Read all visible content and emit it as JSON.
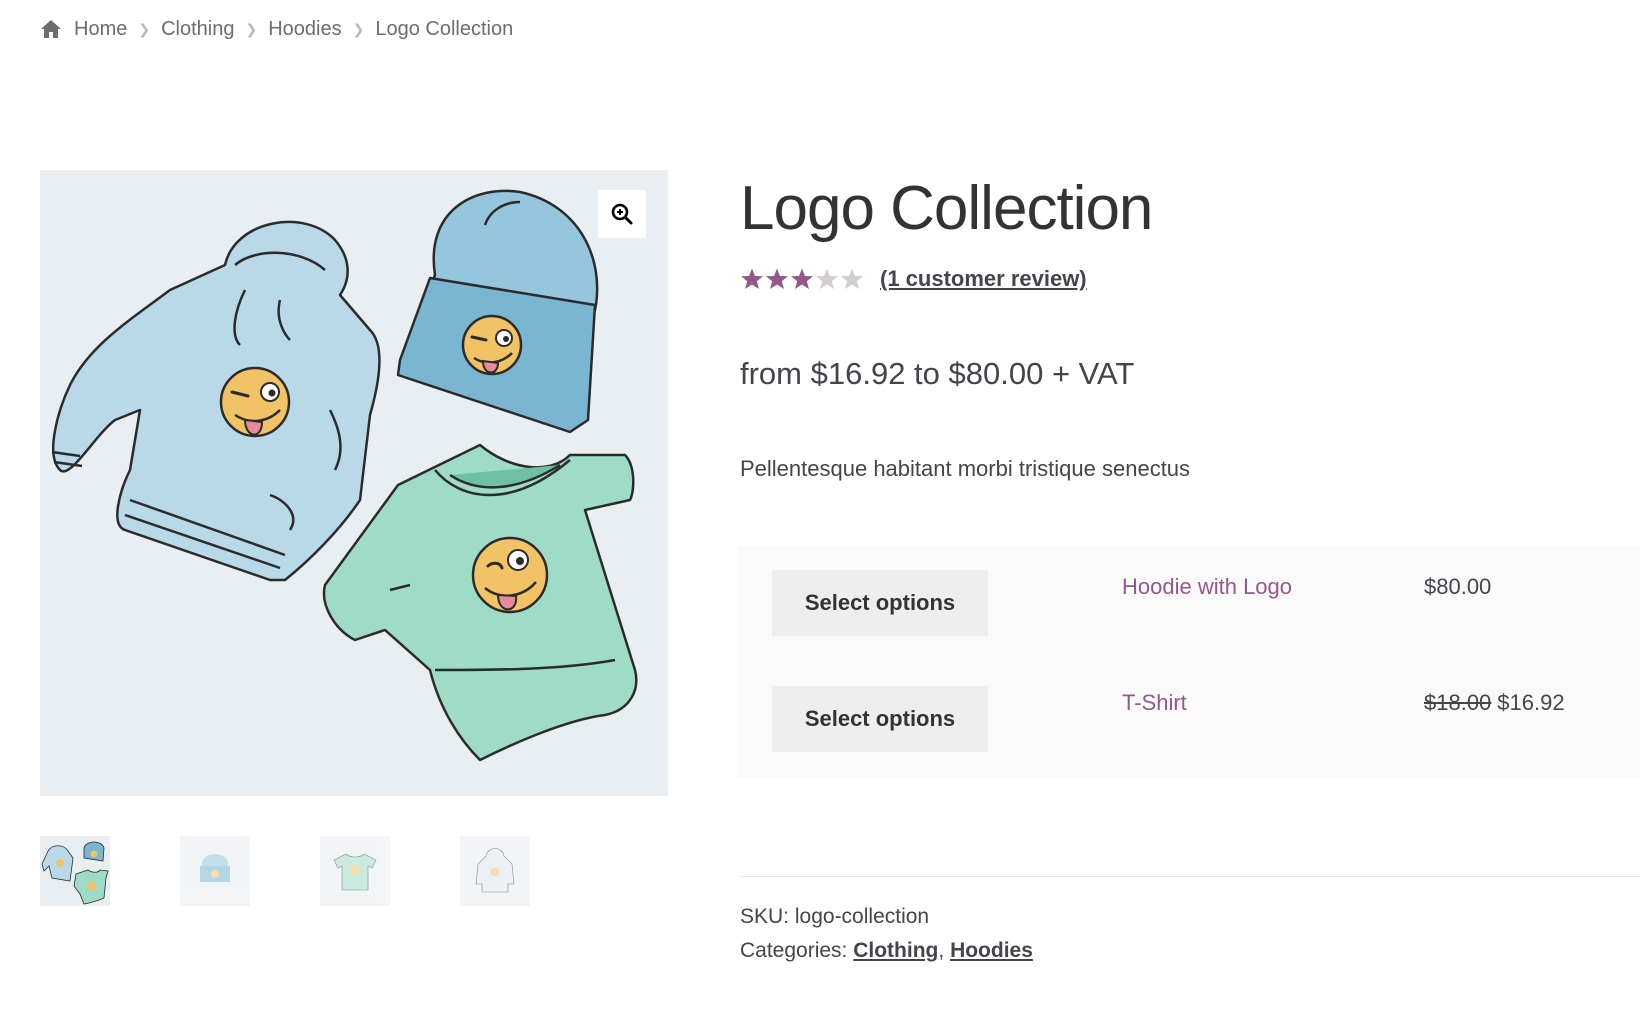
{
  "breadcrumb": {
    "items": [
      {
        "label": "Home"
      },
      {
        "label": "Clothing"
      },
      {
        "label": "Hoodies"
      },
      {
        "label": "Logo Collection"
      }
    ]
  },
  "gallery": {
    "zoom_icon": "zoom-in-icon",
    "thumbnails": [
      {
        "name": "thumb-collection",
        "active": true
      },
      {
        "name": "thumb-beanie",
        "active": false
      },
      {
        "name": "thumb-tshirt",
        "active": false
      },
      {
        "name": "thumb-hoodie",
        "active": false
      }
    ]
  },
  "product": {
    "title": "Logo Collection",
    "rating": {
      "value": 3,
      "max": 5,
      "review_link": "(1 customer review)"
    },
    "price": "from $16.92 to $80.00 + VAT",
    "description": "Pellentesque habitant morbi tristique senectus",
    "grouped": [
      {
        "button": "Select options",
        "name": "Hoodie with Logo",
        "price": "$80.00"
      },
      {
        "button": "Select options",
        "name": "T-Shirt",
        "old_price": "$18.00",
        "price": "$16.92"
      }
    ],
    "meta": {
      "sku_label": "SKU:",
      "sku_value": "logo-collection",
      "categories_label": "Categories:",
      "categories": [
        "Clothing",
        "Hoodies"
      ],
      "categories_separator": ","
    }
  },
  "colors": {
    "accent": "#96588a",
    "star_filled": "#96588a",
    "star_empty": "#d3ced2",
    "image_bg": "#e9eef2"
  }
}
